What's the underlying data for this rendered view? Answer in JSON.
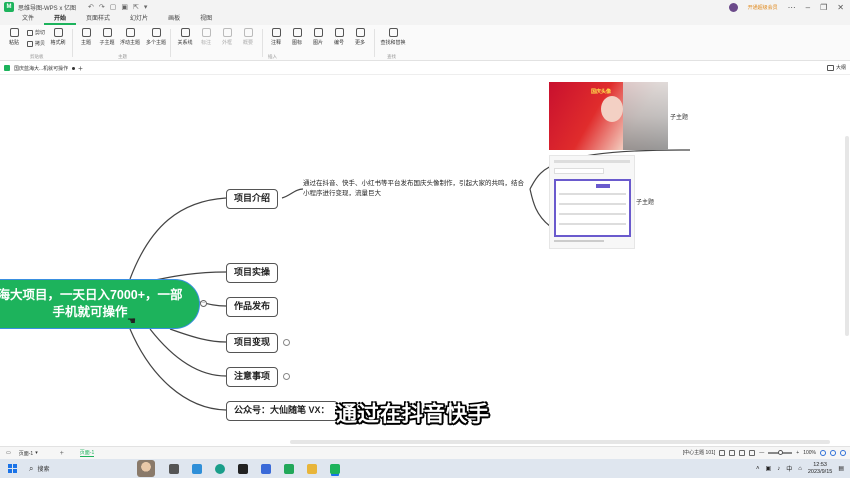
{
  "window": {
    "app_title": "思维导图-WPS x 亿图",
    "logo_text": "M",
    "vip_text": "开通超级会员"
  },
  "menu": {
    "tabs": [
      "文件",
      "开始",
      "页面样式",
      "幻灯片",
      "画板",
      "视图"
    ],
    "active_index": 1
  },
  "ribbon": {
    "paste": "粘贴",
    "cut": "剪切",
    "copy": "拷贝",
    "format_painter": "格式刷",
    "topic": "主题",
    "subtopic": "子主题",
    "floating_topic": "浮动主题",
    "multi_topic": "多个主题",
    "relationship": "关系线",
    "callout": "标注",
    "boundary": "外框",
    "summary": "概要",
    "note": "注释",
    "icon": "图标",
    "image": "图片",
    "numbering": "编号",
    "more": "更多",
    "find_replace": "查找和替换",
    "groups": {
      "clipboard": "剪贴板",
      "topic": "主题",
      "insert": "插入",
      "find": "查找"
    }
  },
  "doc_tab": {
    "name": "国庆蓝海大...机就可操作"
  },
  "outline_button": "大纲",
  "mindmap": {
    "root_line1": "海大项目，一天日入7000+，一部",
    "root_line2": "手机就可操作",
    "branches": [
      {
        "label": "项目介绍"
      },
      {
        "label": "项目实操"
      },
      {
        "label": "作品发布"
      },
      {
        "label": "项目变现"
      },
      {
        "label": "注意事项"
      },
      {
        "label": "公众号：大仙随笔 VX："
      }
    ],
    "description": "通过在抖音、快手、小红书等平台发布国庆头像制作，引起大家的共鸣，结合小程序进行变现，流量巨大",
    "image_subtopic_1": "子主题",
    "image_subtopic_2": "子主题",
    "thumb1_text": "国庆头像"
  },
  "video_subtitle": "通过在抖音快手",
  "statusbar": {
    "page_selector": "页面-1",
    "add_page": "+",
    "page_tab": "页面-1",
    "topic_count": "[中心主题 101]",
    "zoom_minus": "—",
    "zoom_plus": "+",
    "zoom": "100%"
  },
  "taskbar": {
    "search_placeholder": "搜索",
    "time": "12:53",
    "date": "2023/9/15",
    "ime": "中"
  }
}
